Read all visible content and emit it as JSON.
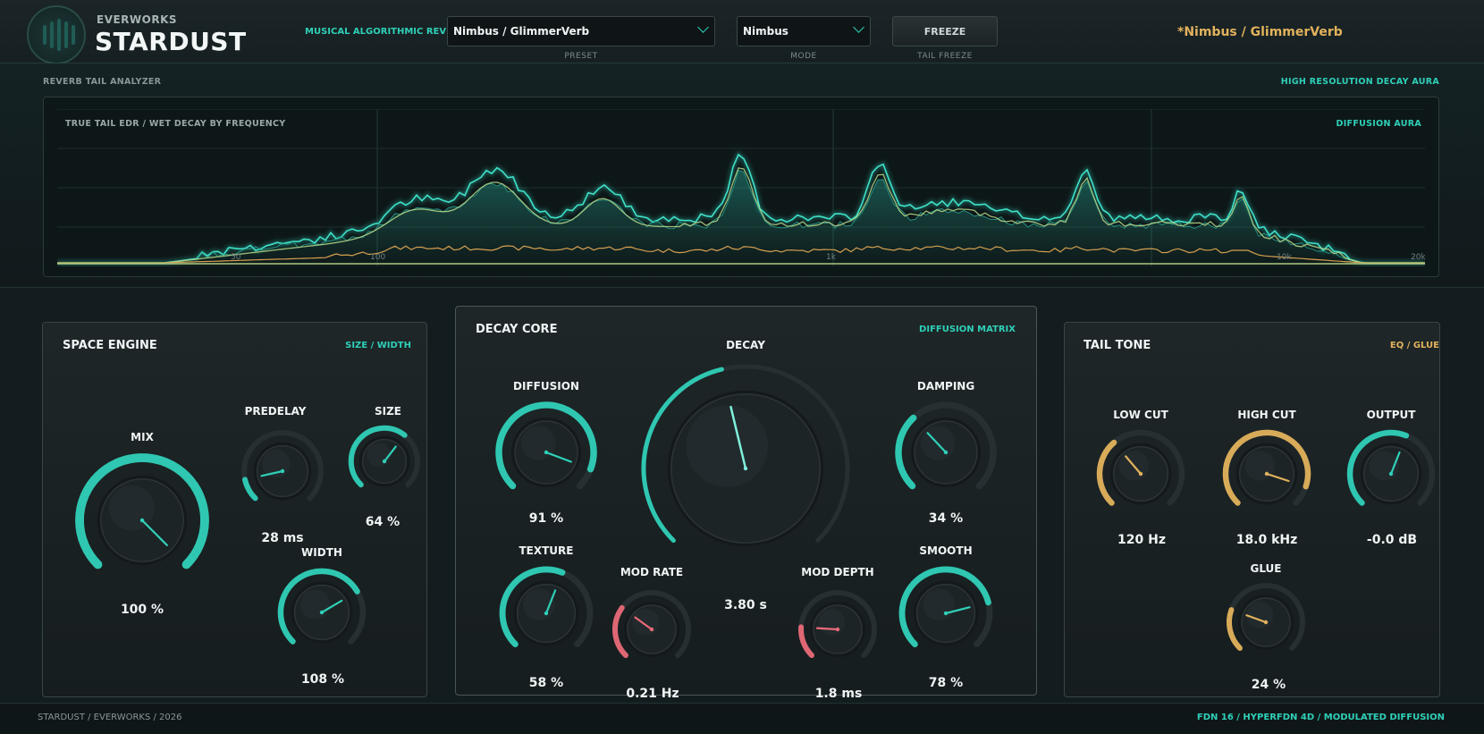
{
  "header": {
    "brand_company": "EVERWORKS",
    "brand_product": "STARDUST",
    "algo_label": "MUSICAL ALGORITHMIC REVERB",
    "preset_select": {
      "value": "Nimbus / GlimmerVerb",
      "caption": "PRESET"
    },
    "mode_select": {
      "value": "Nimbus",
      "caption": "MODE"
    },
    "freeze": {
      "label": "FREEZE",
      "caption": "TAIL FREEZE"
    },
    "current_preset": "*Nimbus / GlimmerVerb"
  },
  "analyzer": {
    "section_label": "REVERB TAIL ANALYZER",
    "section_tag": "HIGH RESOLUTION DECAY AURA",
    "plot_title": "TRUE TAIL EDR  /  WET DECAY BY FREQUENCY",
    "plot_tag": "DIFFUSION AURA",
    "freq_labels": [
      "50",
      "100",
      "1k",
      "10k",
      "20k"
    ]
  },
  "space_engine": {
    "title": "SPACE ENGINE",
    "tag": "SIZE / WIDTH",
    "knobs": {
      "mix": {
        "label": "MIX",
        "value": "100 %",
        "fill": 1.0
      },
      "predelay": {
        "label": "PREDELAY",
        "value": "28 ms",
        "fill": 0.12
      },
      "size": {
        "label": "SIZE",
        "value": "64 %",
        "fill": 0.64
      },
      "width": {
        "label": "WIDTH",
        "value": "108 %",
        "fill": 0.72
      }
    }
  },
  "decay_core": {
    "title": "DECAY CORE",
    "tag": "DIFFUSION MATRIX",
    "knobs": {
      "decay": {
        "label": "DECAY",
        "value": "3.80 s",
        "fill": 0.45
      },
      "diffusion": {
        "label": "DIFFUSION",
        "value": "91 %",
        "fill": 0.91
      },
      "damping": {
        "label": "DAMPING",
        "value": "34 %",
        "fill": 0.34
      },
      "texture": {
        "label": "TEXTURE",
        "value": "58 %",
        "fill": 0.58
      },
      "mod_rate": {
        "label": "MOD RATE",
        "value": "0.21 Hz",
        "fill": 0.3
      },
      "mod_depth": {
        "label": "MOD DEPTH",
        "value": "1.8 ms",
        "fill": 0.18
      },
      "smooth": {
        "label": "SMOOTH",
        "value": "78 %",
        "fill": 0.78
      }
    }
  },
  "tail_tone": {
    "title": "TAIL TONE",
    "tag": "EQ / GLUE",
    "knobs": {
      "low_cut": {
        "label": "LOW CUT",
        "value": "120 Hz",
        "fill": 0.35
      },
      "high_cut": {
        "label": "HIGH CUT",
        "value": "18.0 kHz",
        "fill": 0.9
      },
      "output": {
        "label": "OUTPUT",
        "value": "-0.0 dB",
        "fill": 0.58
      },
      "glue": {
        "label": "GLUE",
        "value": "24 %",
        "fill": 0.24
      }
    }
  },
  "footer": {
    "left": "STARDUST  /  EVERWORKS  /  2026",
    "right": "FDN 16  /  HYPERFDN 4D  /  MODULATED DIFFUSION"
  },
  "colors": {
    "teal": "#2fd0b8",
    "gold": "#e2b25c",
    "red": "#e86a78"
  }
}
